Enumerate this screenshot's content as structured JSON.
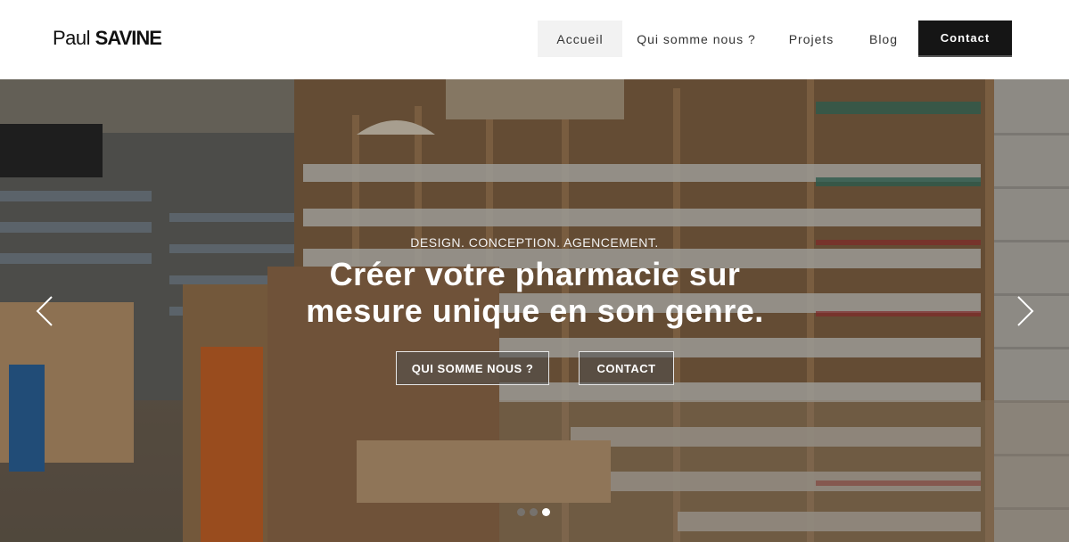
{
  "brand": {
    "first": "Paul",
    "last": "SAVINE"
  },
  "nav": {
    "items": [
      {
        "label": "Accueil",
        "active": true
      },
      {
        "label": "Qui somme nous ?",
        "active": false
      },
      {
        "label": "Projets",
        "active": false
      },
      {
        "label": "Blog",
        "active": false
      }
    ],
    "contact_label": "Contact"
  },
  "hero": {
    "eyebrow": "DESIGN. CONCEPTION. AGENCEMENT.",
    "headline_line1": "Créer votre pharmacie sur",
    "headline_line2": "mesure unique en son genre.",
    "buttons": [
      {
        "label": "QUI SOMME NOUS ?"
      },
      {
        "label": "CONTACT"
      }
    ],
    "slides_total": 3,
    "slide_active": 3,
    "prev_icon": "chevron-left-icon",
    "next_icon": "chevron-right-icon"
  },
  "colors": {
    "contact_button_bg": "#151515",
    "active_nav_bg": "#f2f2f2"
  }
}
